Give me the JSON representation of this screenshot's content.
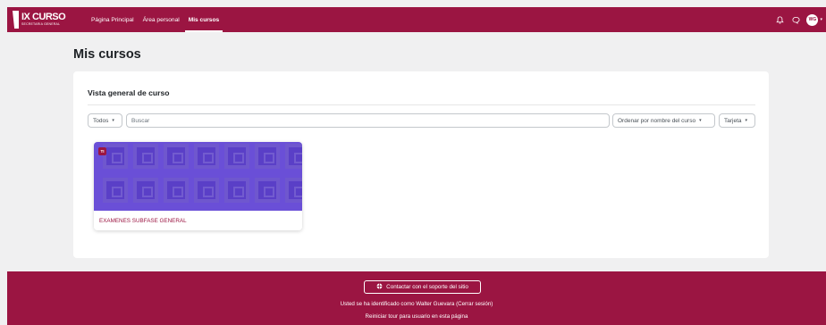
{
  "brand": {
    "title": "IX CURSO",
    "subtitle": "SECRETARIA GENERAL"
  },
  "nav": {
    "links": [
      "Página Principal",
      "Área personal",
      "Mis cursos"
    ],
    "active": "Mis cursos",
    "user_initials": "WG"
  },
  "icons": {
    "notifications": "bell-icon",
    "messages": "chat-bubble-icon",
    "user_menu": "chevron-down-icon"
  },
  "page": {
    "title": "Mis cursos"
  },
  "overview": {
    "title": "Vista general de curso",
    "filter_label": "Todos",
    "search_placeholder": "Buscar",
    "sort_label": "Ordenar por nombre del curso",
    "view_label": "Tarjeta"
  },
  "course": {
    "badge": "TI",
    "name": "EXAMENES SUBFASE GENERAL",
    "image_color": "#6a4fd7"
  },
  "footer": {
    "support_label": "Contactar con el soporte del sitio",
    "logged_in_text": "Usted se ha identificado como Walter Guevara (Cerrar sesión)",
    "tour_text": "Reiniciar tour para usuario en esta página"
  },
  "colors": {
    "brand": "#9b1542",
    "background": "#f0f0f1"
  }
}
